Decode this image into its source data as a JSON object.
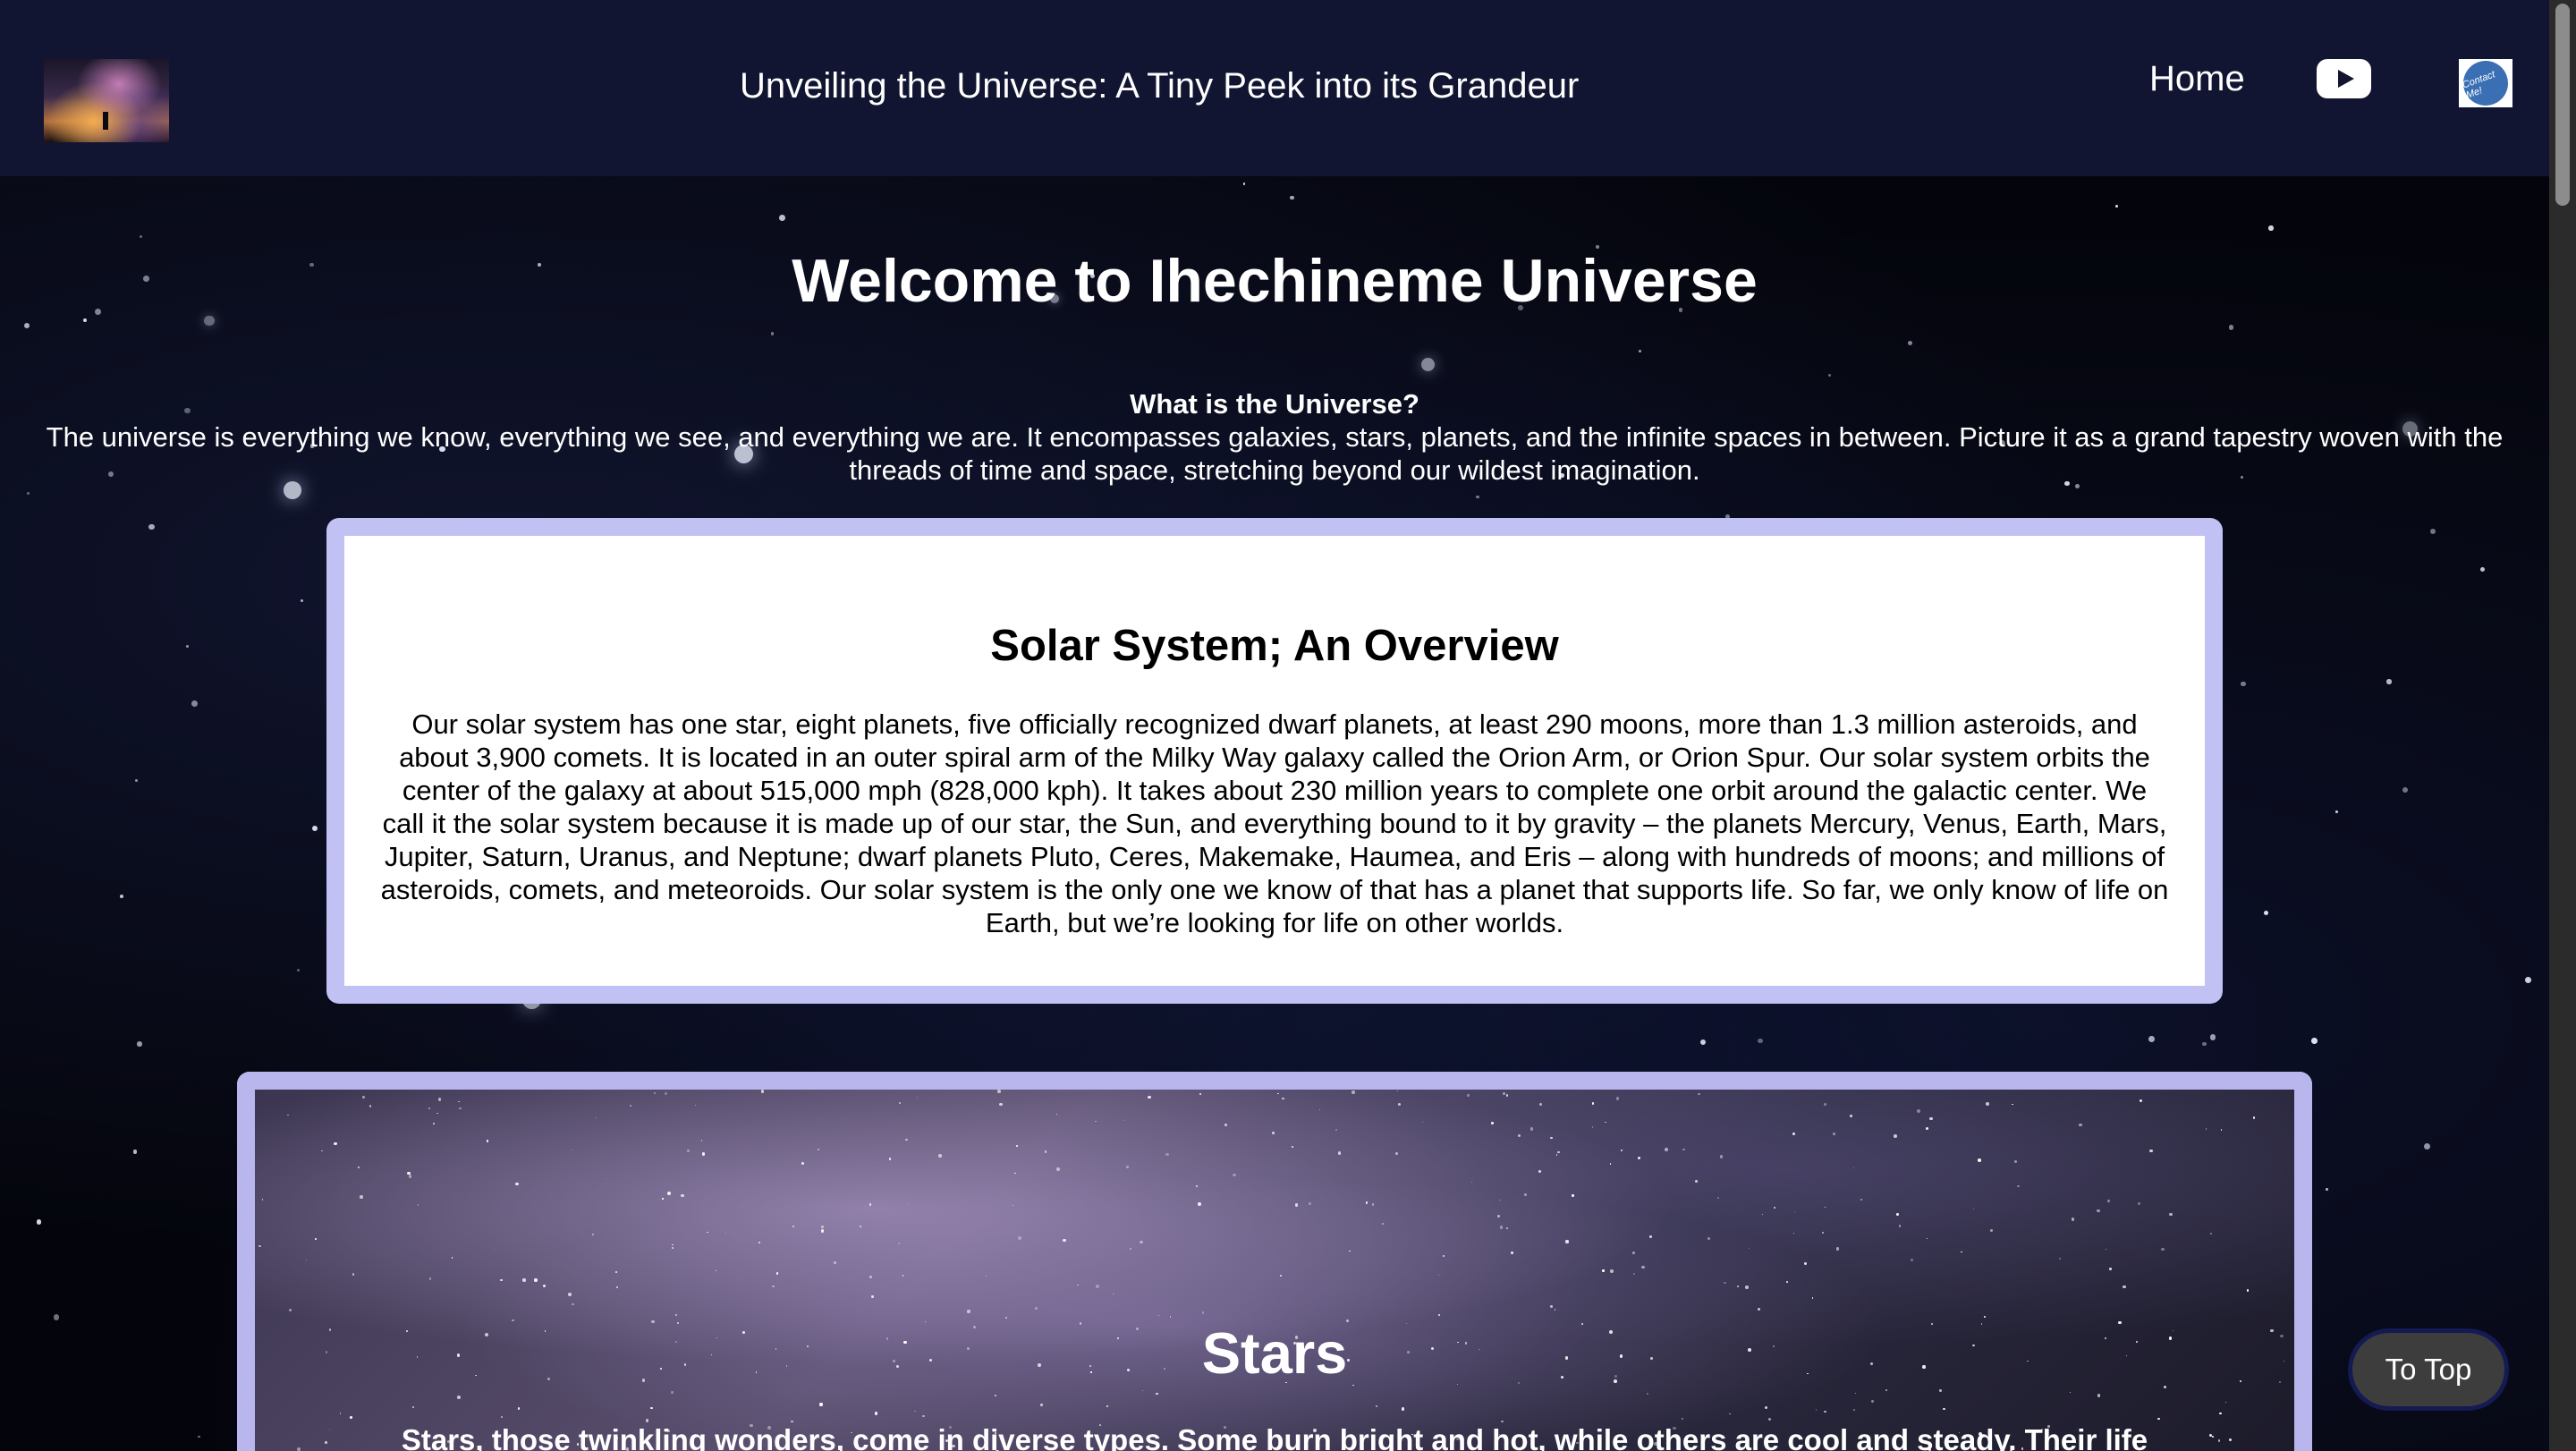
{
  "header": {
    "site_title": "Unveiling the Universe: A Tiny Peek into its Grandeur",
    "nav_home": "Home",
    "youtube_icon": "youtube-icon",
    "contact_icon": "contact-me-icon",
    "contact_badge_text": "Contact Me!"
  },
  "main": {
    "welcome_heading": "Welcome to Ihechineme Universe",
    "question_heading": "What is the Universe?",
    "intro_text": "The universe is everything we know, everything we see, and everything we are. It encompasses galaxies, stars, planets, and the infinite spaces in between. Picture it as a grand tapestry woven with the threads of time and space, stretching beyond our wildest imagination."
  },
  "solar_card": {
    "title": "Solar System; An Overview",
    "body": "Our solar system has one star, eight planets, five officially recognized dwarf planets, at least 290 moons, more than 1.3 million asteroids, and about 3,900 comets. It is located in an outer spiral arm of the Milky Way galaxy called the Orion Arm, or Orion Spur. Our solar system orbits the center of the galaxy at about 515,000 mph (828,000 kph). It takes about 230 million years to complete one orbit around the galactic center. We call it the solar system because it is made up of our star, the Sun, and everything bound to it by gravity – the planets Mercury, Venus, Earth, Mars, Jupiter, Saturn, Uranus, and Neptune; dwarf planets Pluto, Ceres, Makemake, Haumea, and Eris – along with hundreds of moons; and millions of asteroids, comets, and meteoroids. Our solar system is the only one we know of that has a planet that supports life. So far, we only know of life on Earth, but we’re looking for life on other worlds."
  },
  "stars_card": {
    "title": "Stars",
    "body": "Stars, those twinkling wonders, come in diverse types. Some burn bright and hot, while others are cool and steady. Their life cycles"
  },
  "to_top_button": "To Top",
  "colors": {
    "header_bg": "#121531",
    "card_border": "#c1c1f4",
    "to_top_bg": "#3d3d3d",
    "to_top_border": "#141a52"
  }
}
